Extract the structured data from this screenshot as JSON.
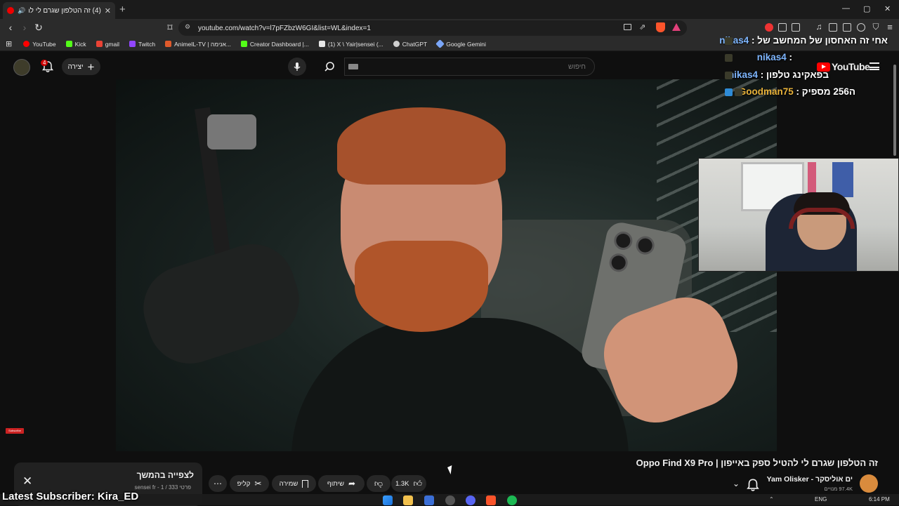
{
  "browser": {
    "tab_title": "(4) זה הטלפון שגרם לי להטיל",
    "url": "youtube.com/watch?v=l7pFZbzW6GI&list=WL&index=1",
    "bookmarks": [
      "YouTube",
      "Kick",
      "gmail",
      "Twitch",
      "AnimeIL-TV | אנימה...",
      "Creator Dashboard |...",
      "(1) X \\ Yair|sensei (...",
      "ChatGPT",
      "Google Gemini"
    ],
    "bookmark_colors": [
      "#ff0000",
      "#53fc18",
      "#ea4335",
      "#9146ff",
      "#e05a2b",
      "#53fc18",
      "#e7e7e7",
      "#d0d0d0",
      "#7aa6f8"
    ]
  },
  "youtube": {
    "notification_count": "4",
    "create_label": "יצירה",
    "search_placeholder": "חיפוש",
    "logo_text": "YouTube"
  },
  "video": {
    "title": "זה הטלפון שגרם לי להטיל ספק באייפון | Oppo Find X9 Pro",
    "channel_name": "ים אוליסקר - Yam Olisker",
    "channel_subs": "97.4K מנויים",
    "likes": "1.3K",
    "share_label": "שיתוף",
    "save_label": "שמירה",
    "clip_label": "קליפ",
    "subscribe_badge": "Subscribe"
  },
  "watch_later": {
    "title": "לצפייה בהמשך",
    "subtitle": "פרטי sensei fr - 1 / 333"
  },
  "stream": {
    "chat": [
      {
        "user": "nikas4",
        "message": "אחי זה האחסון של המחשב של :",
        "color": "#7eb6ff"
      },
      {
        "user": "nikas4",
        "message": ":",
        "color": "#7eb6ff"
      },
      {
        "user": "nikas4",
        "message": "בפאקינג טלפון :",
        "color": "#7eb6ff"
      },
      {
        "user": "Goodman75",
        "message": "ה256 מספיק :",
        "color": "#e8b23a"
      }
    ],
    "latest_subscriber": "Latest Subscriber: Kira_ED"
  },
  "taskbar": {
    "language": "ENG",
    "time": "6:14 PM",
    "date": "12/07/2025"
  }
}
